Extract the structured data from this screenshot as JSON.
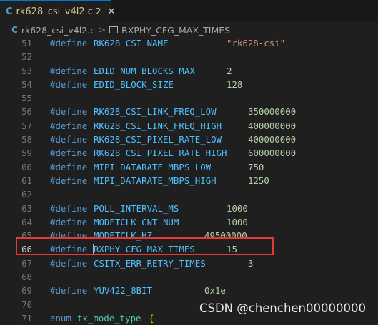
{
  "tab": {
    "icon": "c-language-icon",
    "icon_glyph": "C",
    "filename": "rk628_csi_v4l2.c",
    "problem_count": "2",
    "close_glyph": "✕"
  },
  "breadcrumb": {
    "icon_glyph": "C",
    "file": "rk628_csi_v4l2.c",
    "separator": ">",
    "symbol_icon": "constant-symbol-icon",
    "symbol": "RXPHY_CFG_MAX_TIMES"
  },
  "lines": [
    {
      "num": "51",
      "kw": "#define",
      "name": "RK628_CSI_NAME",
      "value": "\"rk628-csi\""
    },
    {
      "num": "52"
    },
    {
      "num": "53",
      "kw": "#define",
      "name": "EDID_NUM_BLOCKS_MAX",
      "value": "2"
    },
    {
      "num": "54",
      "kw": "#define",
      "name": "EDID_BLOCK_SIZE",
      "value": "128"
    },
    {
      "num": "55"
    },
    {
      "num": "56",
      "kw": "#define",
      "name": "RK628_CSI_LINK_FREQ_LOW",
      "value": "350000000"
    },
    {
      "num": "57",
      "kw": "#define",
      "name": "RK628_CSI_LINK_FREQ_HIGH",
      "value": "400000000"
    },
    {
      "num": "58",
      "kw": "#define",
      "name": "RK628_CSI_PIXEL_RATE_LOW",
      "value": "400000000"
    },
    {
      "num": "59",
      "kw": "#define",
      "name": "RK628_CSI_PIXEL_RATE_HIGH",
      "value": "600000000"
    },
    {
      "num": "60",
      "kw": "#define",
      "name": "MIPI_DATARATE_MBPS_LOW",
      "value": "750"
    },
    {
      "num": "61",
      "kw": "#define",
      "name": "MIPI_DATARATE_MBPS_HIGH",
      "value": "1250"
    },
    {
      "num": "62"
    },
    {
      "num": "63",
      "kw": "#define",
      "name": "POLL_INTERVAL_MS",
      "value": "1000"
    },
    {
      "num": "64",
      "kw": "#define",
      "name": "MODETCLK_CNT_NUM",
      "value": "1000"
    },
    {
      "num": "65",
      "kw": "#define",
      "name": "MODETCLK_HZ",
      "value": "49500000"
    },
    {
      "num": "66",
      "kw": "#define",
      "name": "RXPHY_CFG_MAX_TIMES",
      "value": "15"
    },
    {
      "num": "67",
      "kw": "#define",
      "name": "CSITX_ERR_RETRY_TIMES",
      "value": "3"
    },
    {
      "num": "68"
    },
    {
      "num": "69",
      "kw": "#define",
      "name": "YUV422_8BIT",
      "value": "0x1e"
    },
    {
      "num": "70"
    },
    {
      "num": "71",
      "kw": "enum",
      "name": "tx_mode_type",
      "value": "{"
    }
  ],
  "watermark": "CSDN @chenchen00000000",
  "colors": {
    "background": "#1f1f1f",
    "keyword": "#569cd6",
    "macro": "#4fc1ff",
    "number": "#b5cea8",
    "string": "#ce9178",
    "highlight_border": "#e53935",
    "tab_modified": "#e2c08d"
  }
}
